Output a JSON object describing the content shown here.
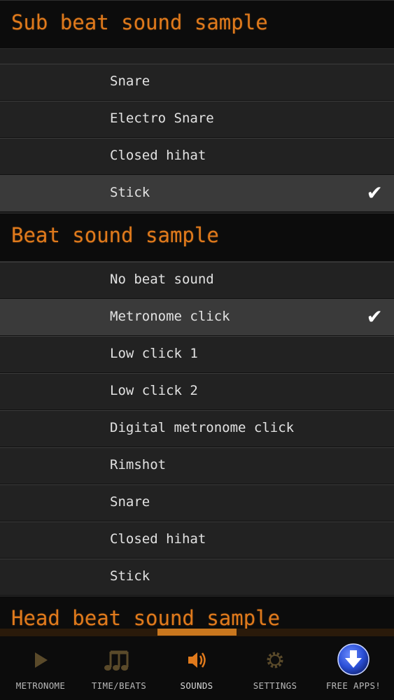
{
  "sections": [
    {
      "title": "Sub beat sound sample",
      "items": [
        {
          "label": "Snare",
          "selected": false
        },
        {
          "label": "Electro Snare",
          "selected": false
        },
        {
          "label": "Closed hihat",
          "selected": false
        },
        {
          "label": "Stick",
          "selected": true
        }
      ]
    },
    {
      "title": "Beat sound sample",
      "items": [
        {
          "label": "No beat sound",
          "selected": false
        },
        {
          "label": "Metronome click",
          "selected": true
        },
        {
          "label": "Low click 1",
          "selected": false
        },
        {
          "label": "Low click 2",
          "selected": false
        },
        {
          "label": "Digital metronome click",
          "selected": false
        },
        {
          "label": "Rimshot",
          "selected": false
        },
        {
          "label": "Snare",
          "selected": false
        },
        {
          "label": "Closed hihat",
          "selected": false
        },
        {
          "label": "Stick",
          "selected": false
        }
      ]
    },
    {
      "title": "Head beat sound sample",
      "items": []
    }
  ],
  "check_mark": "✔",
  "tabs": [
    {
      "label": "METRONOME",
      "icon": "play-icon",
      "active": false
    },
    {
      "label": "TIME/BEATS",
      "icon": "music-notes-icon",
      "active": false
    },
    {
      "label": "SOUNDS",
      "icon": "speaker-icon",
      "active": true
    },
    {
      "label": "SETTINGS",
      "icon": "gear-icon",
      "active": false
    },
    {
      "label": "FREE APPS!",
      "icon": "download-icon",
      "active": false
    }
  ],
  "colors": {
    "accent": "#e07a1c",
    "background": "#1a1a1a",
    "row": "#222222",
    "row_selected": "#3a3a3a"
  }
}
